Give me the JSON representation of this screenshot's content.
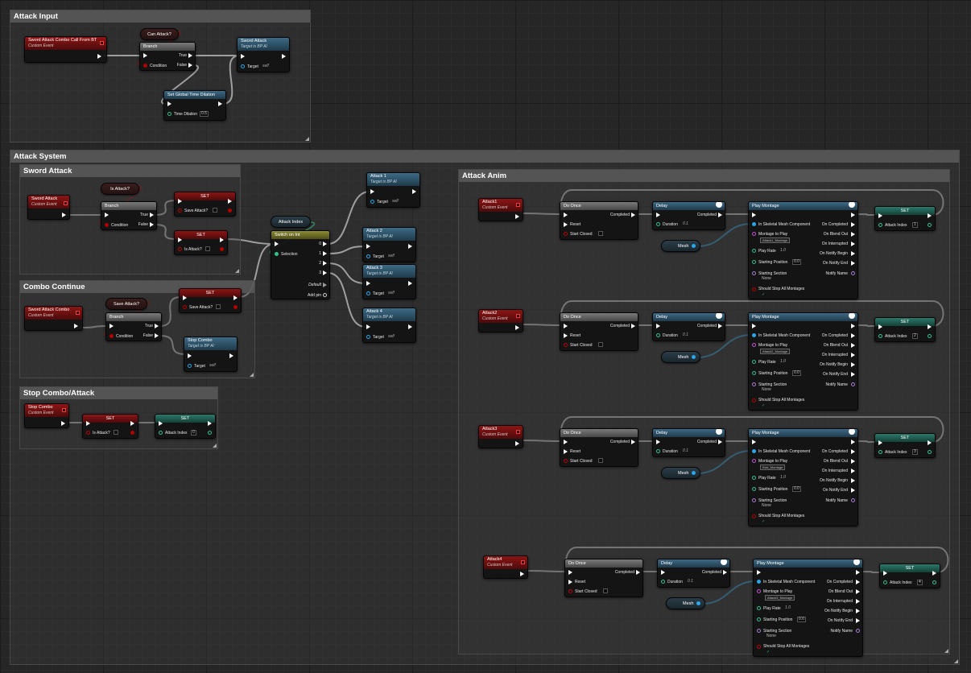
{
  "comments": {
    "attack_input": "Attack Input",
    "attack_system": "Attack System",
    "sword_attack": "Sword Attack",
    "combo_continue": "Combo Continue",
    "stop_combo": "Stop Combo/Attack",
    "attack_anim": "Attack Anim"
  },
  "common": {
    "custom_event": "Custom Event",
    "target_is_bpai": "Target is BP AI",
    "target": "Target",
    "self": "self",
    "true": "True",
    "false": "False",
    "condition": "Condition",
    "branch": "Branch",
    "set": "SET",
    "do_once": "Do Once",
    "reset": "Reset",
    "start_closed": "Start Closed",
    "completed": "Completed",
    "delay": "Delay",
    "duration": "Duration",
    "duration_val": "0.1",
    "mesh": "Mesh",
    "play_montage": "Play Montage",
    "in_skeletal": "In Skeletal Mesh Component",
    "montage_to_play": "Montage to Play",
    "play_rate": "Play Rate",
    "play_rate_val": "1.0",
    "starting_position": "Starting Position",
    "starting_position_val": "0.0",
    "starting_section": "Starting Section",
    "none": "None",
    "should_stop": "Should Stop All Montages",
    "on_completed": "On Completed",
    "on_blend_out": "On Blend Out",
    "on_interrupted": "On Interrupted",
    "on_notify_begin": "On Notify Begin",
    "on_notify_end": "On Notify End",
    "notify_name": "Notify Name",
    "attack_index": "Attack Index"
  },
  "attack_input": {
    "event": "Sword Attack Combo Call From BT",
    "can_attack": "Can Attack?",
    "sword_attack_fn": "Sword Attack",
    "set_time_dilation": "Set Global Time Dilation",
    "time_dilation": "Time Dilation",
    "time_dilation_val": "0.5"
  },
  "sword_attack": {
    "event": "Sword Attack",
    "is_attack": "Is Attack?",
    "save_attack": "Save Attack?"
  },
  "switch": {
    "title": "Switch on Int",
    "selection": "Selection",
    "outs": [
      "0",
      "1",
      "2",
      "3"
    ],
    "default": "Default",
    "add_pin": "Add pin",
    "attack_index_var": "Attack Index"
  },
  "attack_funcs": [
    "Attack 1",
    "Attack 2",
    "Attack 3",
    "Attack 4"
  ],
  "combo_continue": {
    "event": "Sword Attack Combo",
    "save_attack": "Save Attack?",
    "stop_combo": "Stop Combo"
  },
  "stop_combo": {
    "event": "Stop Combo",
    "is_attack": "Is Attack?",
    "attack_index_val": "0"
  },
  "anim_rows": [
    {
      "event": "Attack1",
      "montage": "Attack1_Montage",
      "index": "1"
    },
    {
      "event": "Attack2",
      "montage": "Attack2_Montage",
      "index": "2"
    },
    {
      "event": "Attack3",
      "montage": "Kick_Montage",
      "index": "3"
    },
    {
      "event": "Attack4",
      "montage": "Attack3_Montage",
      "index": "4"
    }
  ]
}
